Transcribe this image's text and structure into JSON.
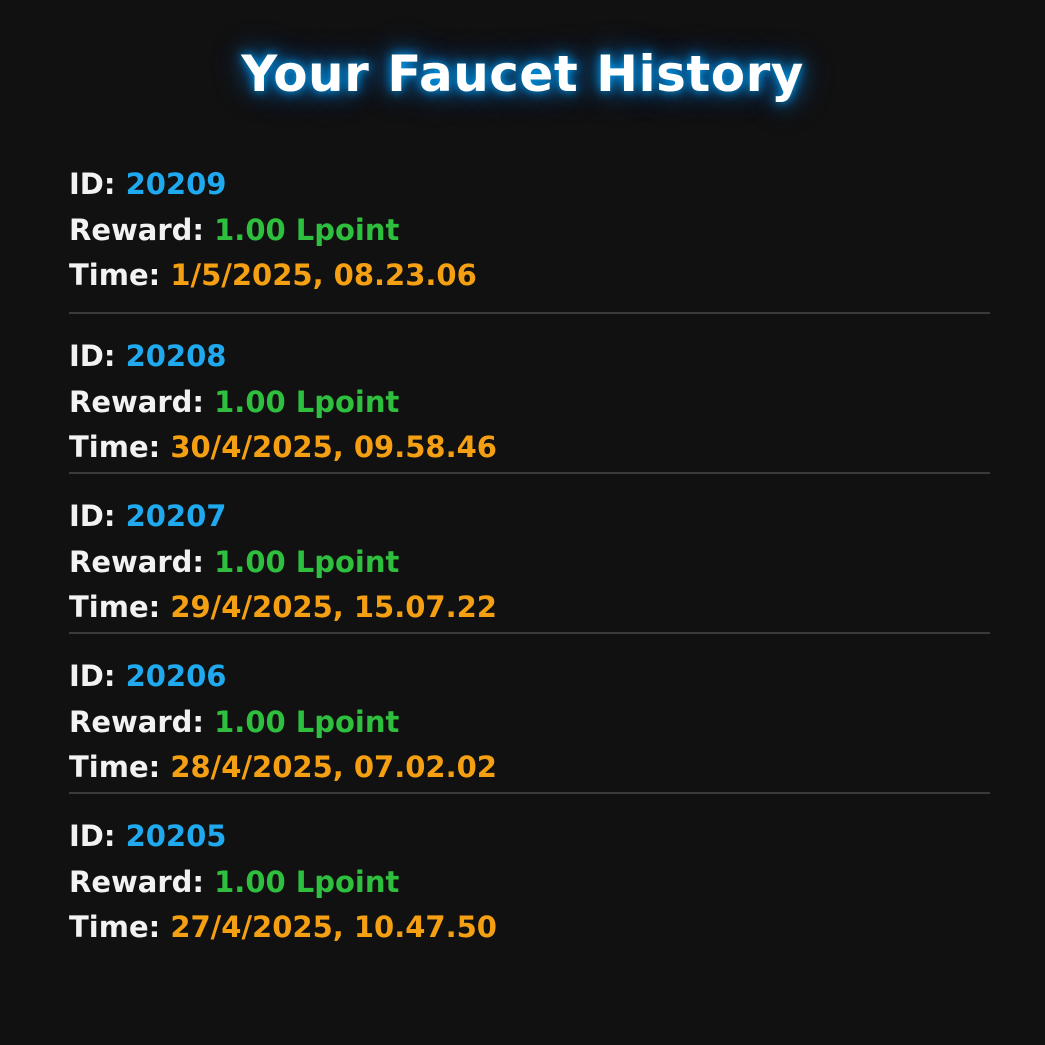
{
  "page": {
    "title": "Your Faucet History"
  },
  "labels": {
    "id": "ID: ",
    "reward": "Reward: ",
    "time": "Time: "
  },
  "colors": {
    "background": "#111111",
    "label": "#f2f2f2",
    "id": "#1fa9ee",
    "reward": "#2fbf3f",
    "time": "#f5a012",
    "divider": "#3a3a3a",
    "title_glow": "#00aaff"
  },
  "history": [
    {
      "id": "20209",
      "reward": "1.00 Lpoint",
      "time": "1/5/2025, 08.23.06"
    },
    {
      "id": "20208",
      "reward": "1.00 Lpoint",
      "time": "30/4/2025, 09.58.46"
    },
    {
      "id": "20207",
      "reward": "1.00 Lpoint",
      "time": "29/4/2025, 15.07.22"
    },
    {
      "id": "20206",
      "reward": "1.00 Lpoint",
      "time": "28/4/2025, 07.02.02"
    },
    {
      "id": "20205",
      "reward": "1.00 Lpoint",
      "time": "27/4/2025, 10.47.50"
    }
  ]
}
